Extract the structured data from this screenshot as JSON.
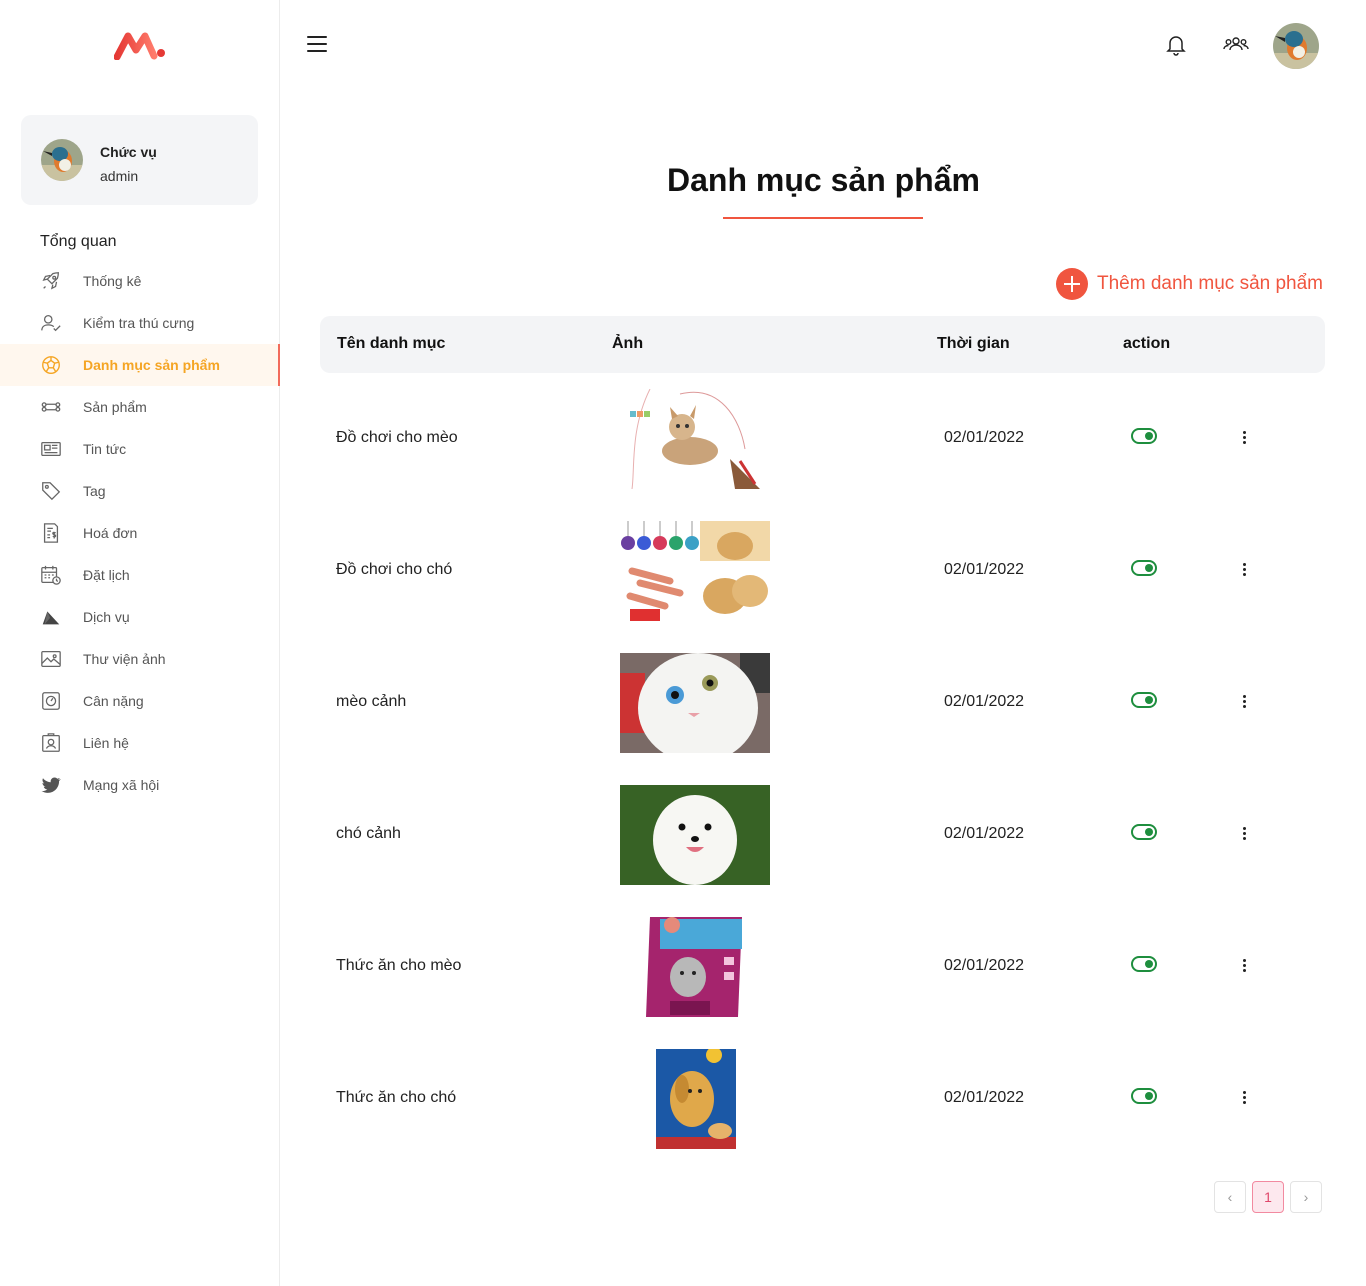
{
  "sidebar": {
    "profile": {
      "role_label": "Chức vụ",
      "role_value": "admin"
    },
    "section_title": "Tổng quan",
    "items": [
      {
        "label": "Thống kê",
        "icon": "rocket-icon",
        "active": false
      },
      {
        "label": "Kiểm tra thú cưng",
        "icon": "user-check-icon",
        "active": false
      },
      {
        "label": "Danh mục sản phẩm",
        "icon": "ball-icon",
        "active": true
      },
      {
        "label": "Sản phẩm",
        "icon": "bone-icon",
        "active": false
      },
      {
        "label": "Tin tức",
        "icon": "newspaper-icon",
        "active": false
      },
      {
        "label": "Tag",
        "icon": "tag-icon",
        "active": false
      },
      {
        "label": "Hoá đơn",
        "icon": "invoice-icon",
        "active": false
      },
      {
        "label": "Đặt lịch",
        "icon": "calendar-icon",
        "active": false
      },
      {
        "label": "Dịch vụ",
        "icon": "service-icon",
        "active": false
      },
      {
        "label": "Thư viện ảnh",
        "icon": "image-icon",
        "active": false
      },
      {
        "label": "Cân nặng",
        "icon": "scale-icon",
        "active": false
      },
      {
        "label": "Liên hệ",
        "icon": "contact-icon",
        "active": false
      },
      {
        "label": "Mạng xã hội",
        "icon": "twitter-icon",
        "active": false
      }
    ]
  },
  "colors": {
    "accent": "#f0553f",
    "active_text": "#f5a524",
    "toggle_on": "#1e8e3e"
  },
  "main": {
    "title": "Danh mục sản phẩm",
    "add_button": "Thêm danh mục sản phẩm",
    "columns": [
      "Tên danh mục",
      "Ảnh",
      "Thời gian",
      "action"
    ],
    "rows": [
      {
        "name": "Đồ chơi cho mèo",
        "date": "02/01/2022",
        "enabled": true
      },
      {
        "name": "Đồ chơi cho chó",
        "date": "02/01/2022",
        "enabled": true
      },
      {
        "name": "mèo cảnh",
        "date": "02/01/2022",
        "enabled": true
      },
      {
        "name": "chó cảnh",
        "date": "02/01/2022",
        "enabled": true
      },
      {
        "name": "Thức ăn cho mèo",
        "date": "02/01/2022",
        "enabled": true
      },
      {
        "name": "Thức ăn cho chó",
        "date": "02/01/2022",
        "enabled": true
      }
    ],
    "pagination": {
      "current_page": "1",
      "prev": "‹",
      "next": "›"
    }
  }
}
